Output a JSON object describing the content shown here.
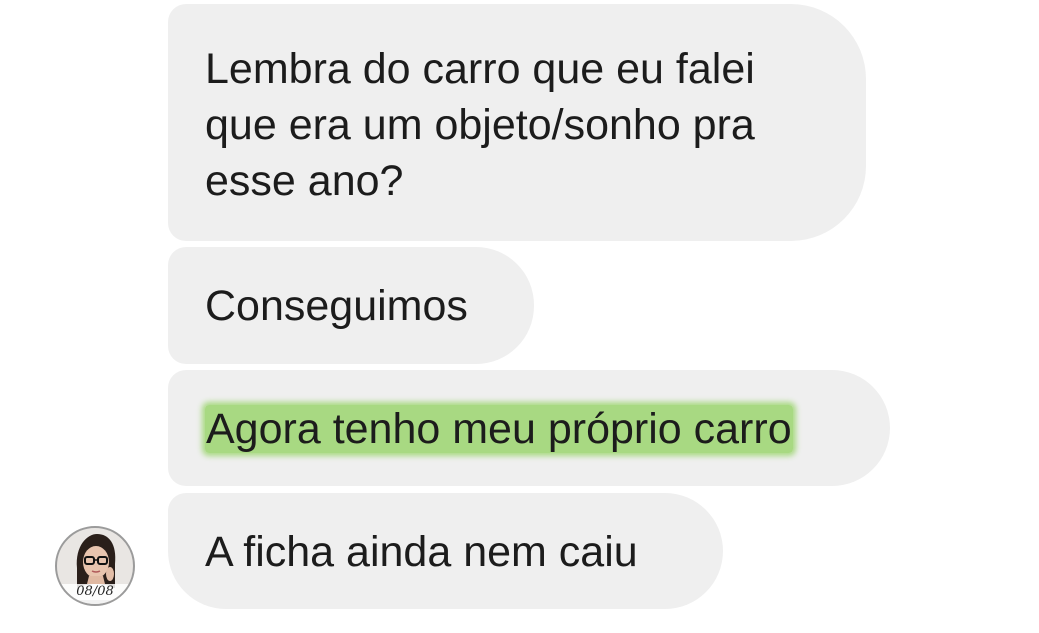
{
  "messages": [
    {
      "text": "Lembra do carro que eu falei que era um objeto/sonho pra esse ano?"
    },
    {
      "text": "Conseguimos"
    },
    {
      "text": "Agora tenho meu próprio carro"
    },
    {
      "text": "A ficha ainda nem caiu"
    }
  ],
  "avatar": {
    "date_label": "08/08"
  },
  "colors": {
    "bubble_bg": "#efefef",
    "text": "#1c1c1c",
    "highlight": "#a8d982"
  }
}
